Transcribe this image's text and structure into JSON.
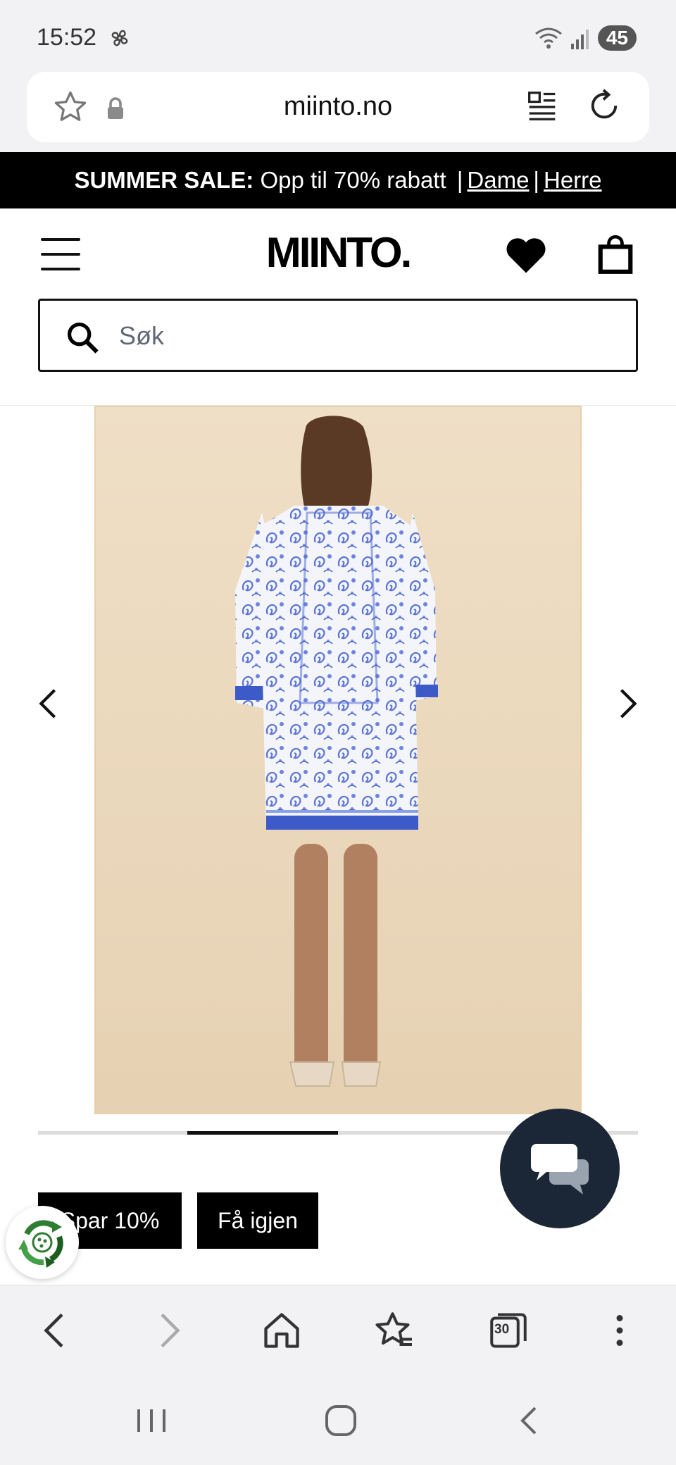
{
  "status_bar": {
    "time": "15:52",
    "battery": "45"
  },
  "browser": {
    "url": "miinto.no"
  },
  "promo": {
    "bold": "SUMMER SALE:",
    "text": "Opp til 70% rabatt",
    "link_women": "Dame",
    "link_men": "Herre"
  },
  "header": {
    "logo": "MIINTO."
  },
  "search": {
    "placeholder": "Søk"
  },
  "gallery": {
    "image_alt": "Product image: blue and white paisley print tunic dress, back view",
    "slide_progress": 0.25
  },
  "actions": {
    "save_label": "Spar 10%",
    "reuse_label": "Få igjen"
  },
  "toolbar": {
    "tabs_count": "30"
  },
  "colors": {
    "promo_bg": "#000000",
    "chat_fab": "#1b2636",
    "image_bg": "#ead7bb"
  }
}
